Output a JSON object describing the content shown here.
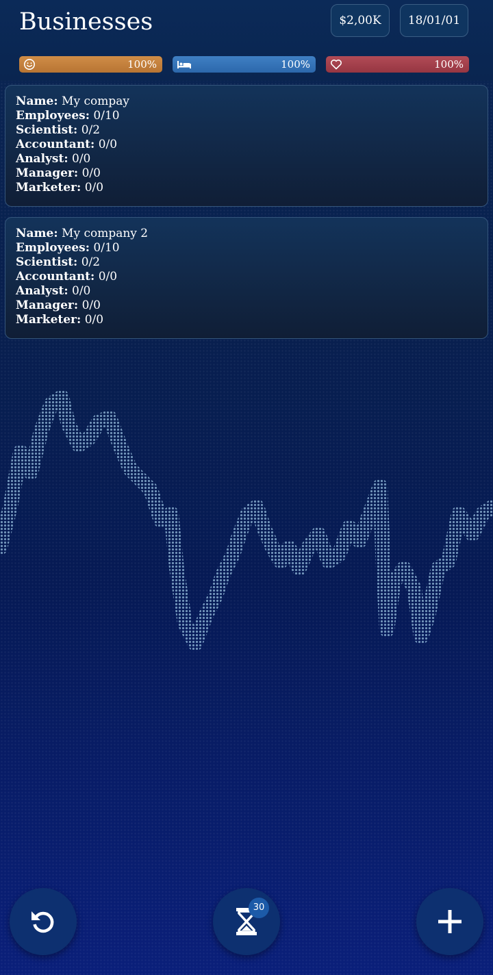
{
  "header": {
    "title": "Businesses",
    "money": "$2,00K",
    "date": "18/01/01"
  },
  "stats": [
    {
      "icon": "smiley-icon",
      "value": "100%",
      "level": 1.0,
      "color": "#c9843f"
    },
    {
      "icon": "bed-icon",
      "value": "100%",
      "level": 1.0,
      "color": "#3575b9"
    },
    {
      "icon": "heart-icon",
      "value": "100%",
      "level": 1.0,
      "color": "#a8434f"
    }
  ],
  "labels": {
    "name": "Name:",
    "employees": "Employees:",
    "scientist": "Scientist:",
    "accountant": "Accountant:",
    "analyst": "Analyst:",
    "manager": "Manager:",
    "marketer": "Marketer:"
  },
  "businesses": [
    {
      "name": "My compay",
      "employees": "0/10",
      "scientist": "0/2",
      "accountant": "0/0",
      "analyst": "0/0",
      "manager": "0/0",
      "marketer": "0/0"
    },
    {
      "name": "My company 2",
      "employees": "0/10",
      "scientist": "0/2",
      "accountant": "0/0",
      "analyst": "0/0",
      "manager": "0/0",
      "marketer": "0/0"
    }
  ],
  "bottom_bar": {
    "undo_icon": "undo-icon",
    "time_icon": "hourglass-icon",
    "time_badge": "30",
    "add_icon": "plus-icon"
  }
}
